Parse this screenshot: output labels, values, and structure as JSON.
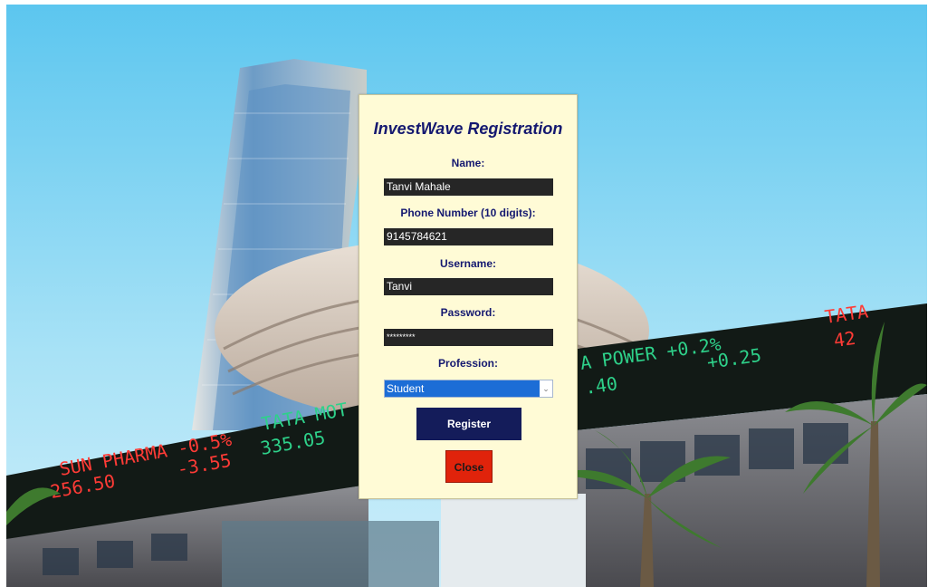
{
  "form": {
    "title": "InvestWave Registration",
    "name_label": "Name:",
    "name_value": "Tanvi Mahale",
    "phone_label": "Phone Number (10 digits):",
    "phone_value": "9145784621",
    "username_label": "Username:",
    "username_value": "Tanvi",
    "password_label": "Password:",
    "password_value": "*********",
    "profession_label": "Profession:",
    "profession_value": "Student",
    "register_label": "Register",
    "close_label": "Close"
  },
  "ticker": {
    "left_line1": "SUN PHARMA -0.5%",
    "left_line2": "-3.55",
    "left_line3": "256.50",
    "mid_line1": "TATA MOT",
    "mid_line2": "335.05",
    "right_line1": "A POWER +0.2%",
    "right_line2": "+0.25",
    "right_line3": ".40",
    "far_line1": "TATA",
    "far_line2": "42"
  },
  "colors": {
    "panel_bg": "#fffbd6",
    "title_text": "#141870",
    "field_bg": "#262626",
    "register_bg": "#141c5a",
    "close_bg": "#e0230b",
    "select_bg": "#1c6dd6"
  },
  "icons": {
    "select_arrow": "chevron-down-icon"
  }
}
